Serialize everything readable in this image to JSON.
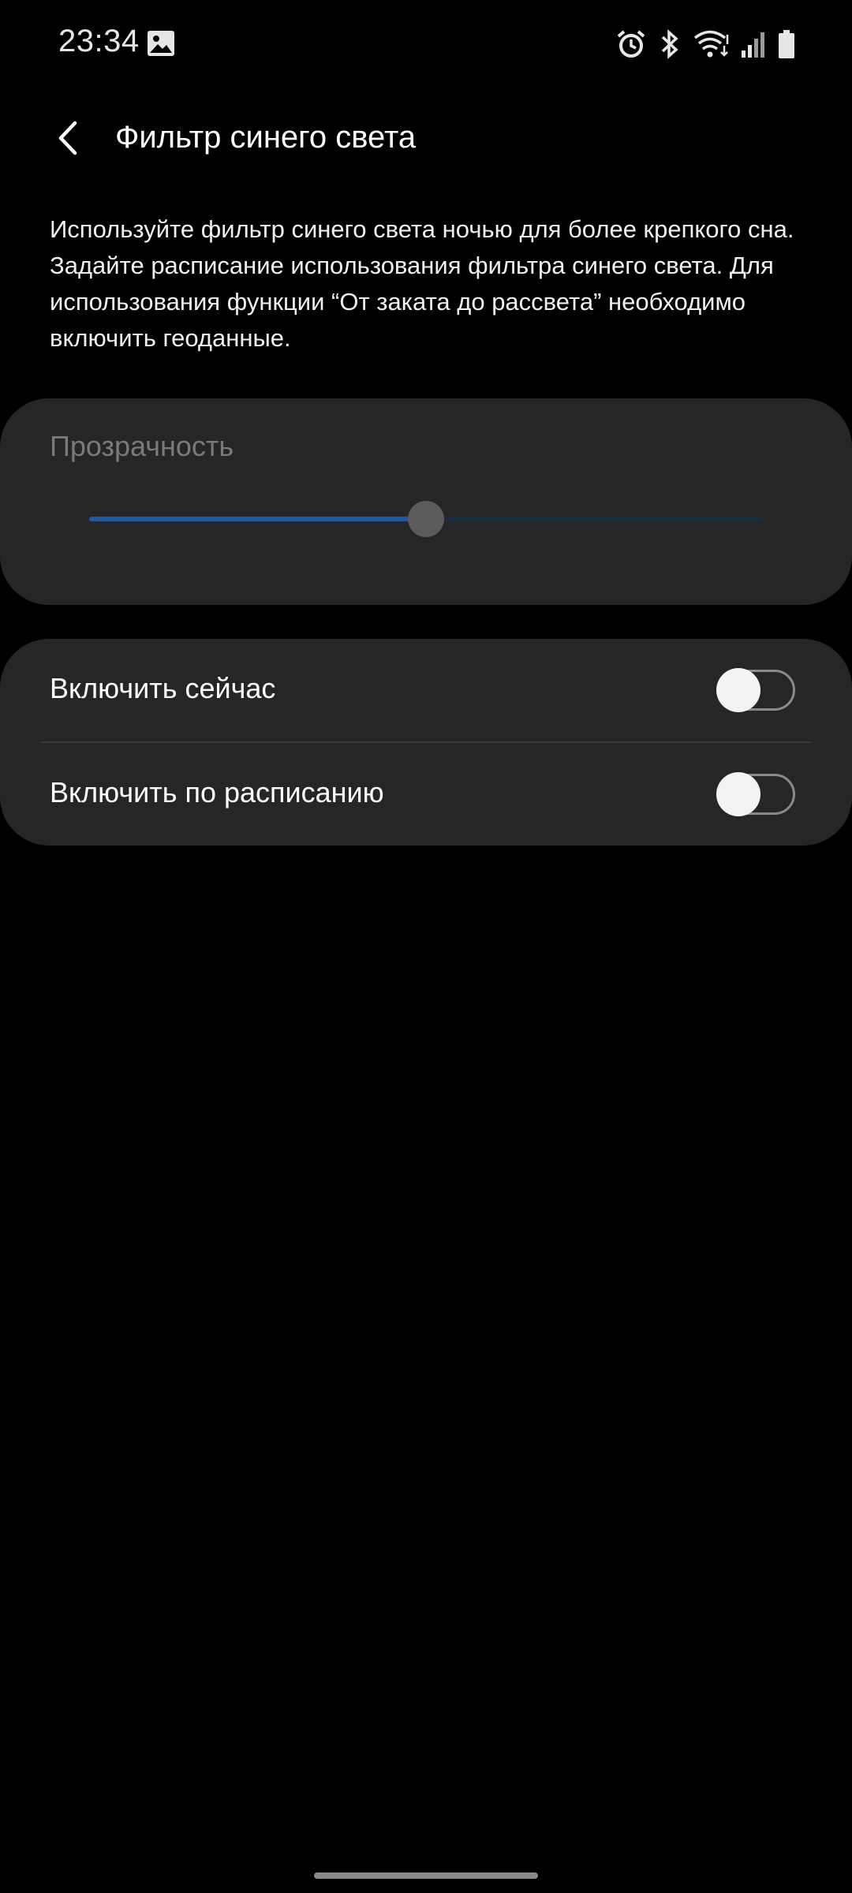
{
  "status_bar": {
    "time": "23:34",
    "icons": [
      "gallery-icon",
      "alarm-icon",
      "bluetooth-icon",
      "wifi-icon",
      "signal-icon",
      "battery-icon"
    ]
  },
  "header": {
    "title": "Фильтр синего света",
    "back_icon": "chevron-left-icon"
  },
  "description": "Используйте фильтр синего света ночью для более крепкого сна. Задайте расписание использования фильтра синего света. Для использования функции “От заката до рассвета” необходимо включить геоданные.",
  "opacity": {
    "label": "Прозрачность",
    "value": 0.5,
    "enabled": false
  },
  "toggles": {
    "turn_on_now": {
      "label": "Включить сейчас",
      "on": false
    },
    "turn_on_scheduled": {
      "label": "Включить по расписанию",
      "on": false
    }
  },
  "colors": {
    "background": "#000000",
    "card": "#262626",
    "slider_fill": "#1e5aa0",
    "slider_track": "#1a2c40",
    "disabled_text": "#7a7a7a"
  }
}
